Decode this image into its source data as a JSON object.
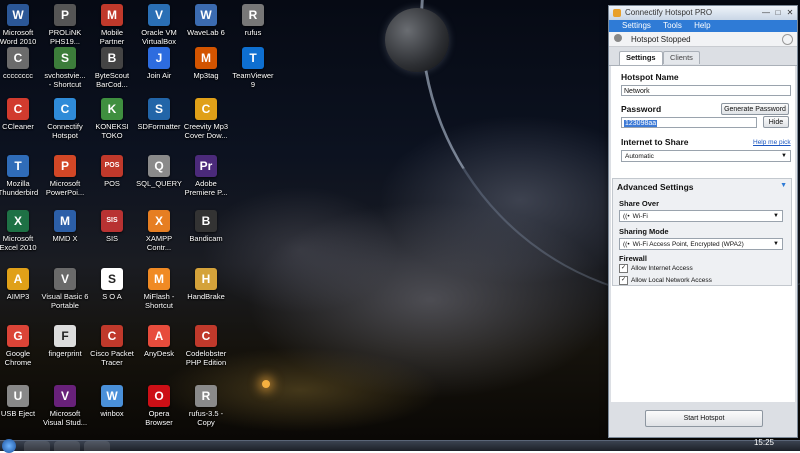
{
  "desktop": {
    "icons": [
      {
        "label": "Microsoft\nWord 2010",
        "glyph": "W",
        "color": "#2b5797",
        "col": 0,
        "row": 0
      },
      {
        "label": "PROLiNK\nPHS19...",
        "glyph": "P",
        "color": "#555555",
        "col": 1,
        "row": 0
      },
      {
        "label": "Mobile\nPartner",
        "glyph": "M",
        "color": "#c0392b",
        "col": 2,
        "row": 0
      },
      {
        "label": "Oracle VM\nVirtualBox",
        "glyph": "V",
        "color": "#2a6fb5",
        "col": 3,
        "row": 0
      },
      {
        "label": "WaveLab 6",
        "glyph": "W",
        "color": "#3b6bb0",
        "col": 4,
        "row": 0
      },
      {
        "label": "rufus",
        "glyph": "R",
        "color": "#777777",
        "col": 5,
        "row": 0
      },
      {
        "label": "cccccccc",
        "glyph": "C",
        "color": "#6b6b6b",
        "col": 0,
        "row": 1
      },
      {
        "label": "svchostvie...\n- Shortcut",
        "glyph": "S",
        "color": "#3c7d3a",
        "col": 1,
        "row": 1
      },
      {
        "label": "ByteScout\nBarCod...",
        "glyph": "B",
        "color": "#444444",
        "col": 2,
        "row": 1
      },
      {
        "label": "Join Air",
        "glyph": "J",
        "color": "#2d6cdf",
        "col": 3,
        "row": 1
      },
      {
        "label": "Mp3tag",
        "glyph": "M",
        "color": "#d35400",
        "col": 4,
        "row": 1
      },
      {
        "label": "TeamViewer\n9",
        "glyph": "T",
        "color": "#0e6fd0",
        "col": 5,
        "row": 1
      },
      {
        "label": "CCleaner",
        "glyph": "C",
        "color": "#d13b2e",
        "col": 0,
        "row": 2
      },
      {
        "label": "Connectify\nHotspot",
        "glyph": "C",
        "color": "#2f8bd8",
        "col": 1,
        "row": 2
      },
      {
        "label": "KONEKSI\nTOKO",
        "glyph": "K",
        "color": "#3f8f3f",
        "col": 2,
        "row": 2
      },
      {
        "label": "SDFormatter",
        "glyph": "S",
        "color": "#2265a8",
        "col": 3,
        "row": 2
      },
      {
        "label": "Creevity Mp3\nCover Dow...",
        "glyph": "C",
        "color": "#e0a018",
        "col": 4,
        "row": 2
      },
      {
        "label": "Mozilla\nThunderbird",
        "glyph": "T",
        "color": "#2f6cb8",
        "col": 0,
        "row": 3
      },
      {
        "label": "Microsoft\nPowerPoi...",
        "glyph": "P",
        "color": "#d24726",
        "col": 1,
        "row": 3
      },
      {
        "label": "POS",
        "glyph": "POS",
        "color": "#c0392b",
        "col": 2,
        "row": 3
      },
      {
        "label": "SQL_QUERY",
        "glyph": "Q",
        "color": "#8a8a8a",
        "col": 3,
        "row": 3
      },
      {
        "label": "Adobe\nPremiere P...",
        "glyph": "Pr",
        "color": "#4b2a7a",
        "col": 4,
        "row": 3
      },
      {
        "label": "Microsoft\nExcel 2010",
        "glyph": "X",
        "color": "#1e7145",
        "col": 0,
        "row": 4
      },
      {
        "label": "MMD X",
        "glyph": "M",
        "color": "#2c5fa8",
        "col": 1,
        "row": 4
      },
      {
        "label": "SIS",
        "glyph": "SIS",
        "color": "#b83232",
        "col": 2,
        "row": 4
      },
      {
        "label": "XAMPP\nContr...",
        "glyph": "X",
        "color": "#e67e22",
        "col": 3,
        "row": 4
      },
      {
        "label": "Bandicam",
        "glyph": "B",
        "color": "#333333",
        "col": 4,
        "row": 4
      },
      {
        "label": "AIMP3",
        "glyph": "A",
        "color": "#e0a018",
        "col": 0,
        "row": 5
      },
      {
        "label": "Visual Basic 6\nPortable",
        "glyph": "V",
        "color": "#6a6a6a",
        "col": 1,
        "row": 5
      },
      {
        "label": "S O A",
        "glyph": "S",
        "color": "#ffffff",
        "col": 2,
        "row": 5
      },
      {
        "label": "MiFlash -\nShortcut",
        "glyph": "M",
        "color": "#f08a24",
        "col": 3,
        "row": 5
      },
      {
        "label": "HandBrake",
        "glyph": "H",
        "color": "#d4a23a",
        "col": 4,
        "row": 5
      },
      {
        "label": "Google\nChrome",
        "glyph": "G",
        "color": "#db4437",
        "col": 0,
        "row": 6
      },
      {
        "label": "fingerprint",
        "glyph": "F",
        "color": "#dddddd",
        "col": 1,
        "row": 6
      },
      {
        "label": "Cisco Packet\nTracer",
        "glyph": "C",
        "color": "#c0392b",
        "col": 2,
        "row": 6
      },
      {
        "label": "AnyDesk",
        "glyph": "A",
        "color": "#e74c3c",
        "col": 3,
        "row": 6
      },
      {
        "label": "Codelobster\nPHP Edition",
        "glyph": "C",
        "color": "#c0392b",
        "col": 4,
        "row": 6
      },
      {
        "label": "USB Eject",
        "glyph": "U",
        "color": "#888888",
        "col": 0,
        "row": 7
      },
      {
        "label": "Microsoft\nVisual Stud...",
        "glyph": "V",
        "color": "#68217a",
        "col": 1,
        "row": 7
      },
      {
        "label": "winbox",
        "glyph": "W",
        "color": "#4a90d9",
        "col": 2,
        "row": 7
      },
      {
        "label": "Opera\nBrowser",
        "glyph": "O",
        "color": "#cc0f16",
        "col": 3,
        "row": 7
      },
      {
        "label": "rufus-3.5 -\nCopy",
        "glyph": "R",
        "color": "#8a8a8a",
        "col": 4,
        "row": 7
      }
    ]
  },
  "window": {
    "title": "Connectify Hotspot PRO",
    "controls": {
      "minimize": "—",
      "maximize": "□",
      "close": "✕"
    },
    "menu": [
      "Settings",
      "Tools",
      "Help"
    ],
    "status": "Hotspot Stopped",
    "tabs": {
      "settings": "Settings",
      "clients": "Clients"
    },
    "hotspot_name": {
      "label": "Hotspot Name",
      "value": "Network"
    },
    "password": {
      "label": "Password",
      "value": "123098aa",
      "generate": "Generate Password",
      "hide": "Hide"
    },
    "internet": {
      "label": "Internet to Share",
      "help": "Help me pick",
      "value": "Automatic"
    },
    "advanced": {
      "title": "Advanced Settings",
      "share_over_label": "Share Over",
      "share_over_value": "Wi-Fi",
      "sharing_mode_label": "Sharing Mode",
      "sharing_mode_value": "Wi-Fi Access Point, Encrypted (WPA2)",
      "firewall_label": "Firewall",
      "allow_internet": "Allow Internet Access",
      "allow_local": "Allow Local Network Access"
    },
    "start_button": "Start Hotspot"
  },
  "taskbar": {
    "clock": "15:25"
  }
}
